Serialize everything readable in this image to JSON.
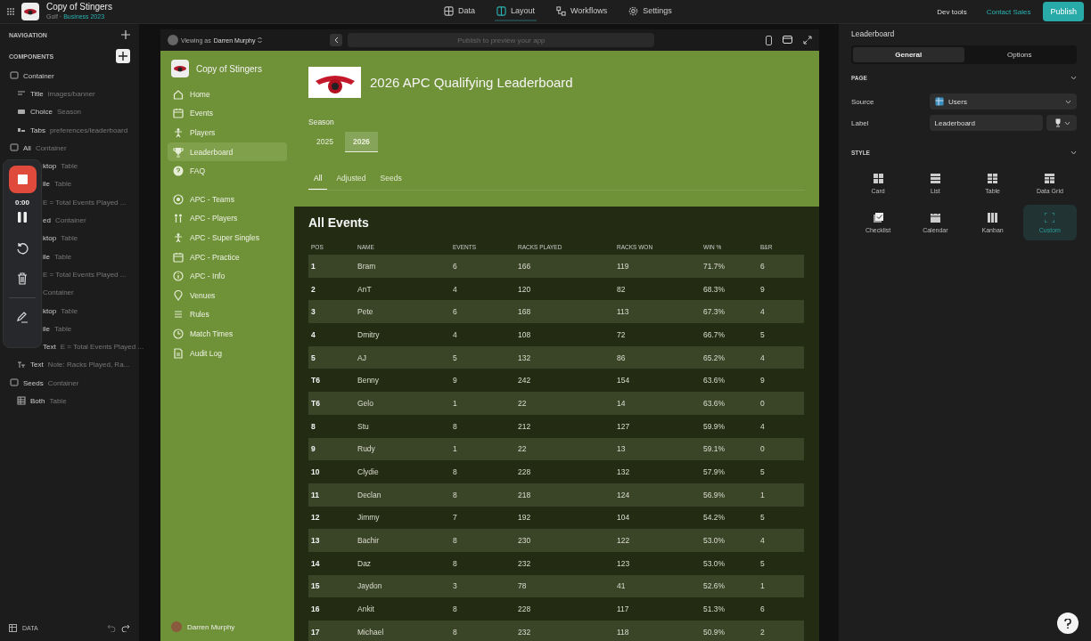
{
  "topbar": {
    "app_title": "Copy of Stingers",
    "plan": "Golf ·",
    "tier": "Business 2023",
    "tabs": [
      {
        "label": "Data",
        "kind": "grid",
        "selected": false
      },
      {
        "label": "Layout",
        "kind": "layout",
        "selected": true
      },
      {
        "label": "Workflows",
        "kind": "flow",
        "selected": false
      },
      {
        "label": "Settings",
        "kind": "gear",
        "selected": false
      }
    ],
    "dev_tools": "Dev tools",
    "contact": "Contact Sales",
    "publish": "Publish"
  },
  "sidebar": {
    "navigation": "NAVIGATION",
    "components": "COMPONENTS",
    "items": [
      {
        "kind": "container",
        "label": "Container"
      },
      {
        "kind": "title",
        "label": "Title",
        "detail": "images/banner"
      },
      {
        "kind": "choice",
        "label": "Choice",
        "detail": "Season"
      },
      {
        "kind": "tabs",
        "label": "Tabs",
        "detail": "preferences/leaderboard"
      },
      {
        "kind": "container",
        "label": "All",
        "detail": "Container"
      },
      {
        "kind": "covered",
        "label": "ktop",
        "detail": "Table"
      },
      {
        "kind": "covered",
        "label": "ile",
        "detail": "Table"
      },
      {
        "kind": "covered",
        "detail": "E = Total Events Played ..."
      },
      {
        "kind": "covered",
        "label": "ed",
        "detail": "Container"
      },
      {
        "kind": "covered",
        "label": "ktop",
        "detail": "Table"
      },
      {
        "kind": "covered",
        "label": "ile",
        "detail": "Table"
      },
      {
        "kind": "covered",
        "detail": "E = Total Events Played ..."
      },
      {
        "kind": "covered",
        "detail": "Container"
      },
      {
        "kind": "covered",
        "label": "ktop",
        "detail": "Table"
      },
      {
        "kind": "covered",
        "label": "ile",
        "detail": "Table"
      },
      {
        "kind": "covered",
        "label": "Text",
        "detail": "E = Total Events Played ..."
      },
      {
        "kind": "text",
        "label": "Text",
        "detail": "Note: Racks Played, Ra..."
      },
      {
        "kind": "container",
        "label": "Seeds",
        "detail": "Container"
      },
      {
        "kind": "table",
        "label": "Both",
        "detail": "Table"
      }
    ],
    "data": "DATA"
  },
  "recorder": {
    "time": "0:00"
  },
  "preview": {
    "viewing_as": "Viewing as",
    "user": "Darren Murphy",
    "url_placeholder": "Publish to preview your app"
  },
  "app": {
    "name": "Copy of Stingers",
    "nav_groups": [
      [
        {
          "label": "Home",
          "kind": "home",
          "selected": false
        },
        {
          "label": "Events",
          "kind": "calendar",
          "selected": false
        },
        {
          "label": "Players",
          "kind": "person",
          "selected": false
        },
        {
          "label": "Leaderboard",
          "kind": "trophy",
          "selected": true
        },
        {
          "label": "FAQ",
          "kind": "question",
          "selected": false
        }
      ],
      [
        {
          "label": "APC - Teams",
          "kind": "ball",
          "selected": false
        },
        {
          "label": "APC - Players",
          "kind": "people",
          "selected": false
        },
        {
          "label": "APC - Super Singles",
          "kind": "person",
          "selected": false
        },
        {
          "label": "APC - Practice",
          "kind": "calendar",
          "selected": false
        },
        {
          "label": "APC - Info",
          "kind": "info",
          "selected": false
        },
        {
          "label": "Venues",
          "kind": "pin",
          "selected": false
        },
        {
          "label": "Rules",
          "kind": "list",
          "selected": false
        },
        {
          "label": "Match Times",
          "kind": "clock",
          "selected": false
        },
        {
          "label": "Audit Log",
          "kind": "doc",
          "selected": false
        }
      ]
    ],
    "user": "Darren Murphy"
  },
  "page": {
    "title": "2026 APC Qualifying Leaderboard",
    "season_label": "Season",
    "seasons": [
      {
        "label": "2025",
        "selected": false
      },
      {
        "label": "2026",
        "selected": true
      }
    ],
    "tabs": [
      {
        "label": "All",
        "selected": true
      },
      {
        "label": "Adjusted",
        "selected": false
      },
      {
        "label": "Seeds",
        "selected": false
      }
    ],
    "table": {
      "title": "All Events",
      "columns": [
        "POS",
        "NAME",
        "EVENTS",
        "RACKS PLAYED",
        "RACKS WON",
        "WIN %",
        "B&R"
      ],
      "rows": [
        [
          "1",
          "Bram",
          "6",
          "166",
          "119",
          "71.7%",
          "6"
        ],
        [
          "2",
          "AnT",
          "4",
          "120",
          "82",
          "68.3%",
          "9"
        ],
        [
          "3",
          "Pete",
          "6",
          "168",
          "113",
          "67.3%",
          "4"
        ],
        [
          "4",
          "Dmitry",
          "4",
          "108",
          "72",
          "66.7%",
          "5"
        ],
        [
          "5",
          "AJ",
          "5",
          "132",
          "86",
          "65.2%",
          "4"
        ],
        [
          "T6",
          "Benny",
          "9",
          "242",
          "154",
          "63.6%",
          "9"
        ],
        [
          "T6",
          "Gelo",
          "1",
          "22",
          "14",
          "63.6%",
          "0"
        ],
        [
          "8",
          "Stu",
          "8",
          "212",
          "127",
          "59.9%",
          "4"
        ],
        [
          "9",
          "Rudy",
          "1",
          "22",
          "13",
          "59.1%",
          "0"
        ],
        [
          "10",
          "Clydie",
          "8",
          "228",
          "132",
          "57.9%",
          "5"
        ],
        [
          "11",
          "Declan",
          "8",
          "218",
          "124",
          "56.9%",
          "1"
        ],
        [
          "12",
          "Jimmy",
          "7",
          "192",
          "104",
          "54.2%",
          "5"
        ],
        [
          "13",
          "Bachir",
          "8",
          "230",
          "122",
          "53.0%",
          "4"
        ],
        [
          "14",
          "Daz",
          "8",
          "232",
          "123",
          "53.0%",
          "5"
        ],
        [
          "15",
          "Jaydon",
          "3",
          "78",
          "41",
          "52.6%",
          "1"
        ],
        [
          "16",
          "Ankit",
          "8",
          "228",
          "117",
          "51.3%",
          "6"
        ],
        [
          "17",
          "Michael",
          "8",
          "232",
          "118",
          "50.9%",
          "2"
        ]
      ]
    }
  },
  "inspector": {
    "title": "Leaderboard",
    "tabs": [
      {
        "label": "General",
        "selected": true
      },
      {
        "label": "Options",
        "selected": false
      }
    ],
    "page_section": "PAGE",
    "source_label": "Source",
    "source_value": "Users",
    "label_label": "Label",
    "label_value": "Leaderboard",
    "style_section": "STYLE",
    "styles": [
      {
        "label": "Card",
        "selected": false
      },
      {
        "label": "List",
        "selected": false
      },
      {
        "label": "Table",
        "selected": false
      },
      {
        "label": "Data Grid",
        "selected": false
      },
      {
        "label": "Checklist",
        "selected": false
      },
      {
        "label": "Calendar",
        "selected": false
      },
      {
        "label": "Kanban",
        "selected": false
      },
      {
        "label": "Custom",
        "selected": true
      }
    ]
  }
}
